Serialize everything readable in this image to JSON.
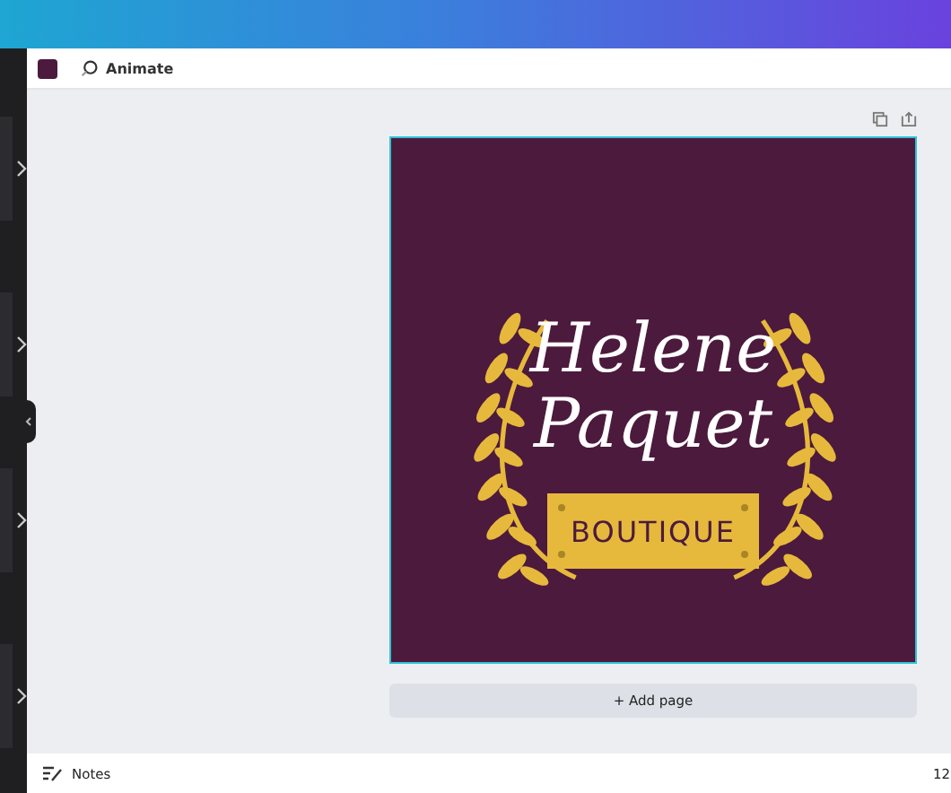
{
  "toolbar": {
    "swatch": {
      "color": "#4c1a3d"
    },
    "animate": "Animate"
  },
  "design": {
    "name_lines": [
      "Helene",
      "Paquet"
    ],
    "plaque": "BOUTIQUE"
  },
  "add_page": "+ Add page",
  "footer": {
    "notes": "Notes",
    "zoom": "12"
  }
}
